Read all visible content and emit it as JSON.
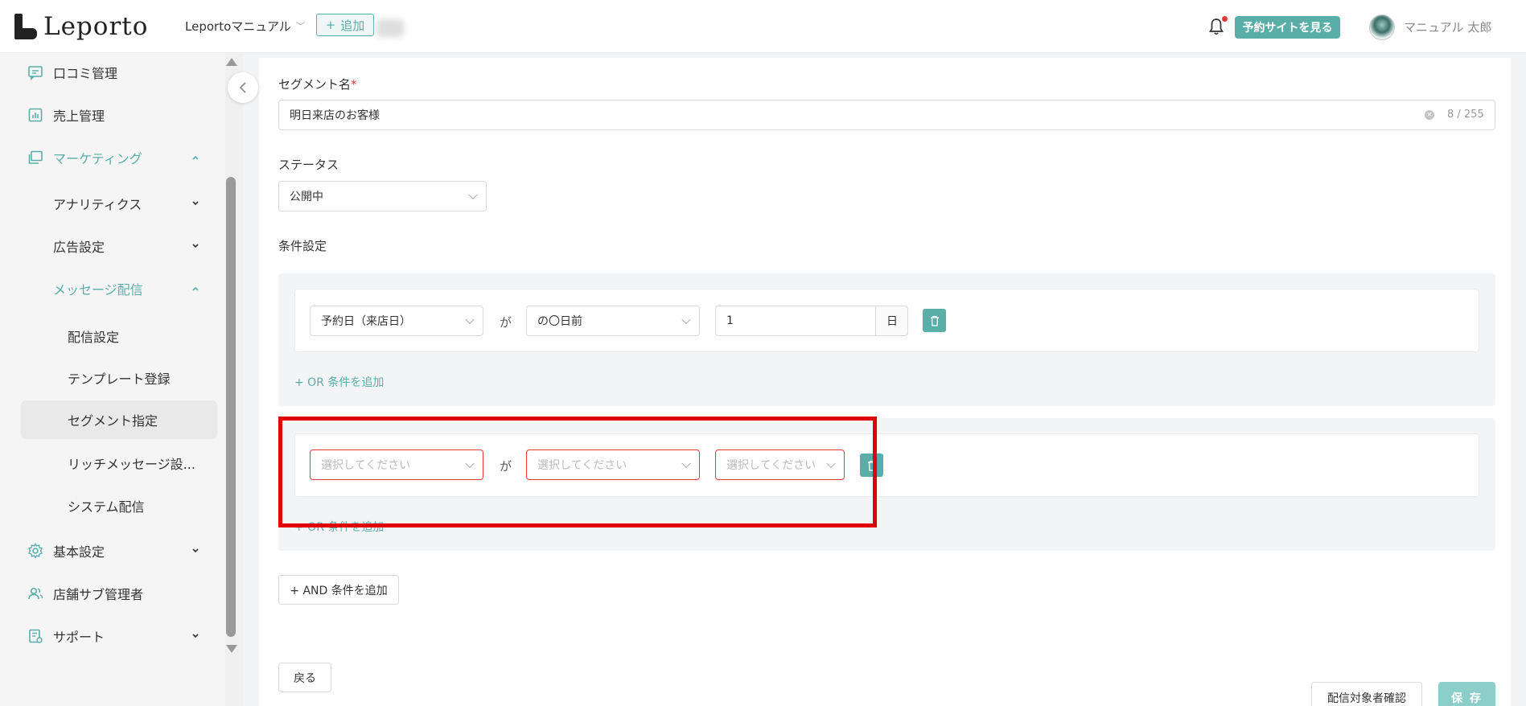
{
  "header": {
    "logo_text": "Leporto",
    "shop_select": "Leportoマニュアル",
    "add_button": "追加",
    "view_site_button": "予約サイトを見る",
    "user_name": "マニュアル 太郎"
  },
  "sidebar": {
    "items": [
      {
        "label": "口コミ管理",
        "icon": "comment-icon"
      },
      {
        "label": "売上管理",
        "icon": "chart-icon"
      },
      {
        "label": "マーケティング",
        "icon": "marketing-icon"
      },
      {
        "label": "アナリティクス"
      },
      {
        "label": "広告設定"
      },
      {
        "label": "メッセージ配信"
      },
      {
        "label": "配信設定"
      },
      {
        "label": "テンプレート登録"
      },
      {
        "label": "セグメント指定"
      },
      {
        "label": "リッチメッセージ設..."
      },
      {
        "label": "システム配信"
      },
      {
        "label": "基本設定",
        "icon": "gear-icon"
      },
      {
        "label": "店舗サブ管理者",
        "icon": "users-icon"
      },
      {
        "label": "サポート",
        "icon": "support-icon"
      }
    ]
  },
  "form": {
    "segment_name_label": "セグメント名",
    "required_mark": "*",
    "segment_name_value": "明日来店のお客様",
    "segment_name_counter": "8 / 255",
    "status_label": "ステータス",
    "status_value": "公開中",
    "conditions_label": "条件設定",
    "condition1": {
      "field": "予約日（来店日）",
      "ga": "が",
      "operator": "の〇日前",
      "value": "1",
      "unit": "日"
    },
    "or_add": "+ OR 条件を追加",
    "condition2": {
      "field_placeholder": "選択してください",
      "ga": "が",
      "operator_placeholder": "選択してください",
      "value_placeholder": "選択してください"
    },
    "or_add_2": "+ OR 条件を追加",
    "and_add": "+ AND 条件を追加",
    "back_button": "戻る",
    "confirm_button": "配信対象者確認",
    "save_button": "保 存"
  },
  "colors": {
    "accent": "#5aaea8",
    "error": "#e53935",
    "highlight": "#e00000"
  }
}
